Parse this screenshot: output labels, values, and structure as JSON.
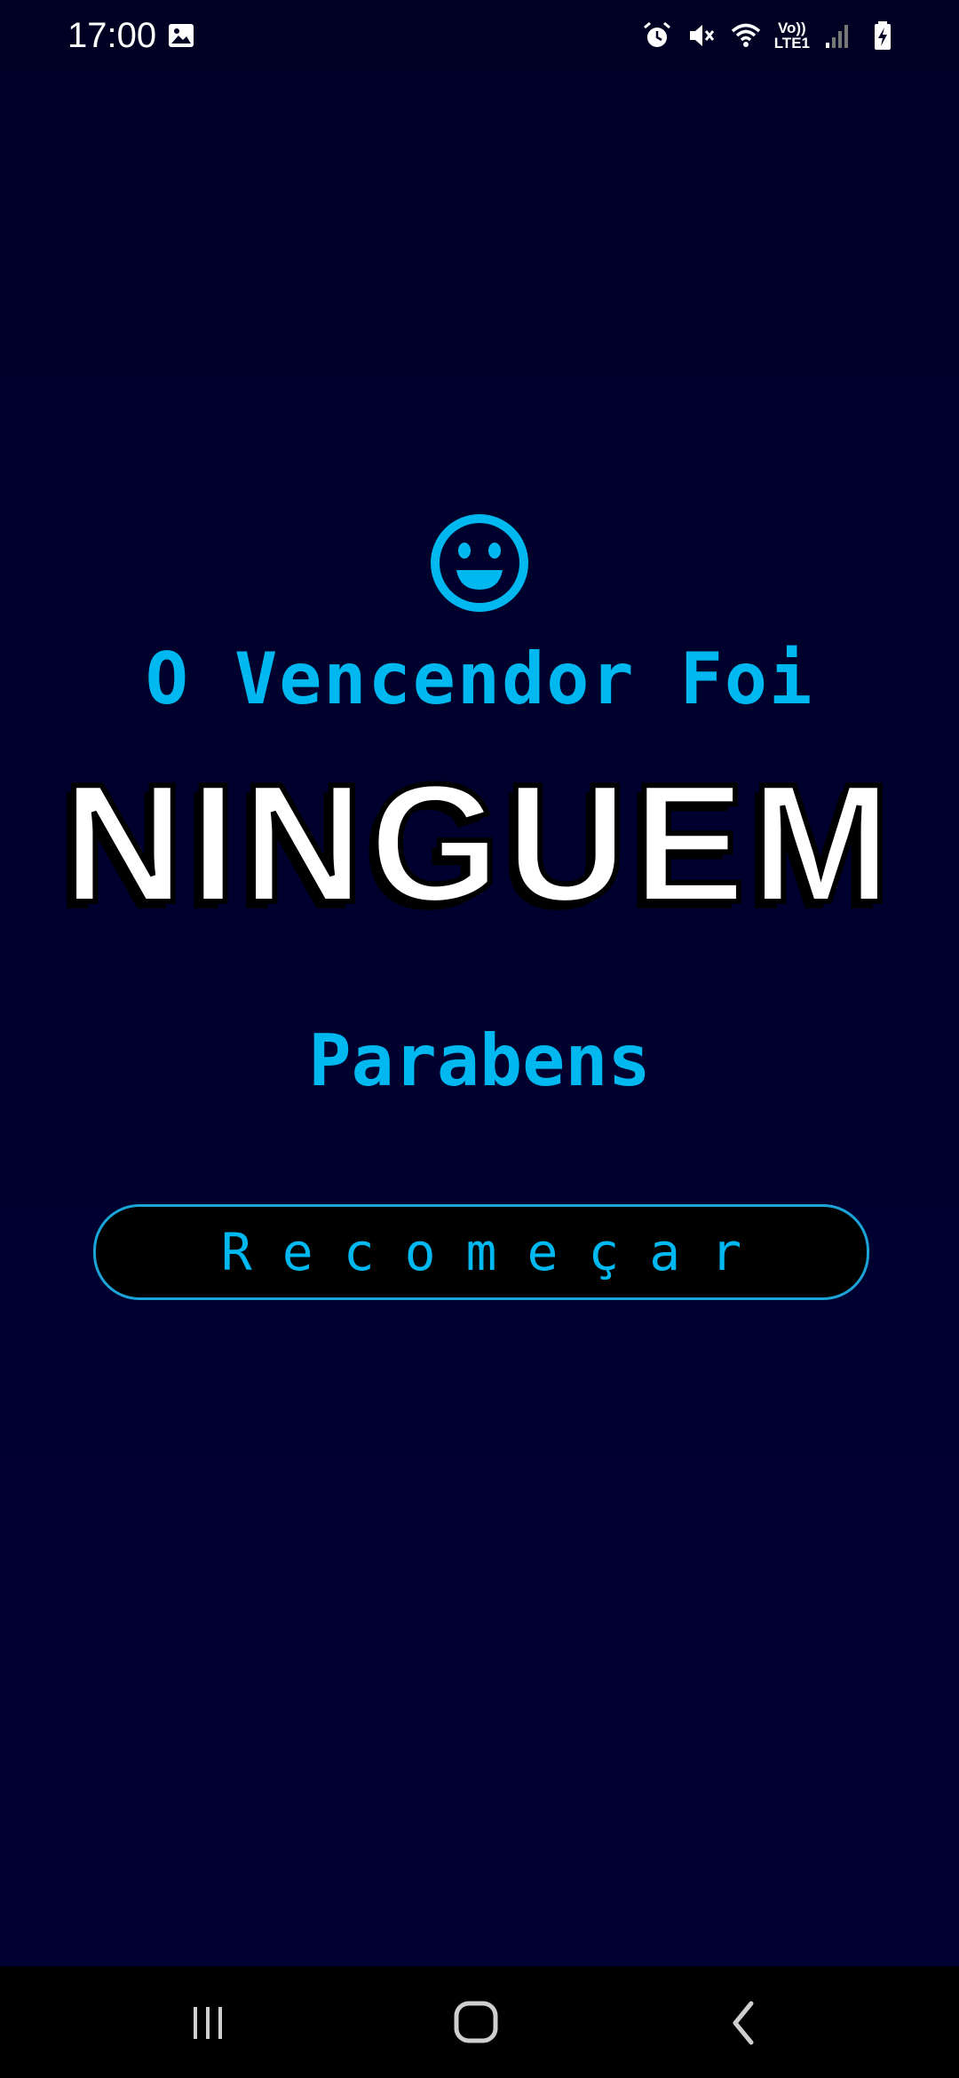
{
  "status_bar": {
    "time": "17:00",
    "network_label": "Vo))\nLTE1",
    "icons": [
      "image-icon",
      "alarm-icon",
      "mute-icon",
      "wifi-icon",
      "signal-icon",
      "battery-charging-icon"
    ]
  },
  "game_over": {
    "icon": "smiley-icon",
    "winner_label": "O Vencendor Foi",
    "winner_name": "NINGUEM",
    "congrats": "Parabens",
    "restart_label": "Recomeçar"
  },
  "nav_bar": {
    "icons": [
      "recent-apps-icon",
      "home-icon",
      "back-icon"
    ]
  },
  "colors": {
    "background": "#00002e",
    "accent": "#00b8f0",
    "button_border": "#1aa4d8",
    "title_fill": "#ffffff"
  }
}
